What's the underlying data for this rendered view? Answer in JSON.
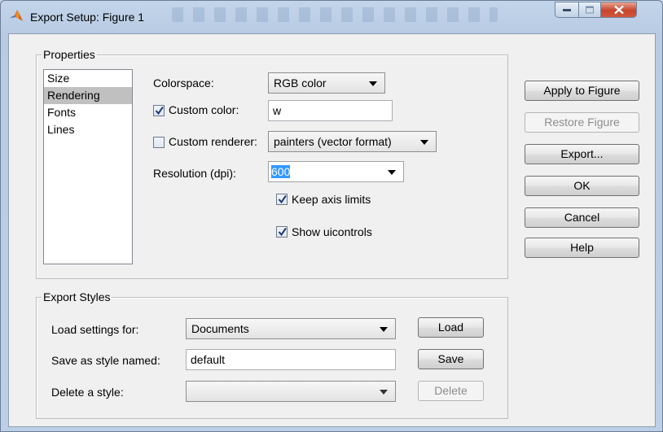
{
  "window": {
    "title": "Export Setup: Figure 1",
    "accent_close": "#c7432c"
  },
  "properties": {
    "legend": "Properties",
    "categories": [
      {
        "label": "Size",
        "selected": false
      },
      {
        "label": "Rendering",
        "selected": true
      },
      {
        "label": "Fonts",
        "selected": false
      },
      {
        "label": "Lines",
        "selected": false
      }
    ],
    "colorspace": {
      "label": "Colorspace:",
      "value": "RGB color"
    },
    "custom_color": {
      "label": "Custom color:",
      "checked": true,
      "value": "w"
    },
    "custom_renderer": {
      "label": "Custom renderer:",
      "checked": false,
      "value": "painters (vector format)"
    },
    "resolution": {
      "label": "Resolution (dpi):",
      "value": "600"
    },
    "keep_axis_limits": {
      "label": "Keep axis limits",
      "checked": true
    },
    "show_uicontrols": {
      "label": "Show uicontrols",
      "checked": true
    }
  },
  "export_styles": {
    "legend": "Export Styles",
    "load_label": "Load settings for:",
    "load_value": "Documents",
    "load_button": "Load",
    "save_label": "Save as style named:",
    "save_value": "default",
    "save_button": "Save",
    "delete_label": "Delete a style:",
    "delete_value": "",
    "delete_button": "Delete"
  },
  "actions": {
    "apply": "Apply to Figure",
    "restore": "Restore Figure",
    "export": "Export...",
    "ok": "OK",
    "cancel": "Cancel",
    "help": "Help"
  }
}
